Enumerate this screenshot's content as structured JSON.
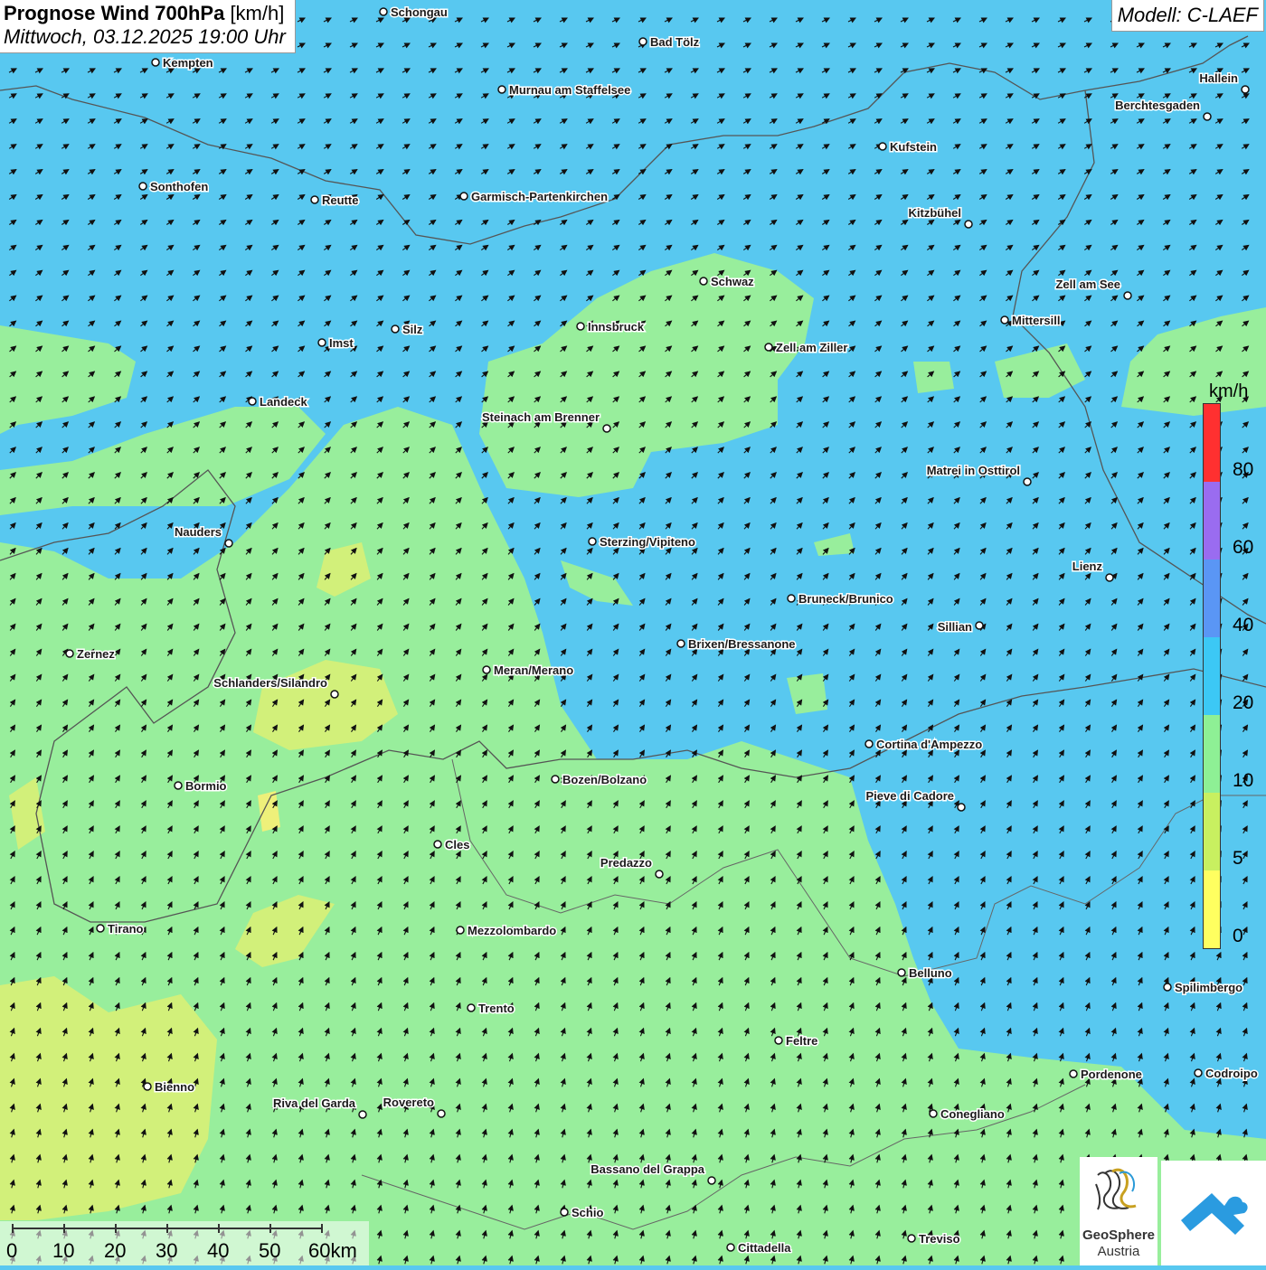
{
  "header": {
    "title_bold": "Prognose Wind 700hPa",
    "title_unit": "[km/h]",
    "datetime": "Mittwoch, 03.12.2025 19:00 Uhr",
    "model": "Modell: C-LAEF"
  },
  "legend": {
    "unit": "km/h",
    "stops": [
      {
        "label": "80",
        "color": "#ff3030"
      },
      {
        "label": "60",
        "color": "#9a6cf0"
      },
      {
        "label": "40",
        "color": "#5a96f5"
      },
      {
        "label": "20",
        "color": "#3cc8f5"
      },
      {
        "label": "10",
        "color": "#8ef095"
      },
      {
        "label": "5",
        "color": "#c8f060"
      },
      {
        "label": "0",
        "color": "#ffff60"
      }
    ],
    "labels_order": [
      "80",
      "60",
      "40",
      "20",
      "10",
      "5",
      "0"
    ]
  },
  "scalebar": {
    "labels": [
      "0",
      "10",
      "20",
      "30",
      "40",
      "50",
      "60km"
    ]
  },
  "brand": {
    "line1": "GeoSphere",
    "line2": "Austria"
  },
  "cities": [
    {
      "name": "Schongau"
    },
    {
      "name": "Bad Tölz"
    },
    {
      "name": "Kempten"
    },
    {
      "name": "Murnau am Staffelsee"
    },
    {
      "name": "Hallein"
    },
    {
      "name": "Berchtesgaden"
    },
    {
      "name": "Kufstein"
    },
    {
      "name": "Sonthofen"
    },
    {
      "name": "Reutte"
    },
    {
      "name": "Garmisch-Partenkirchen"
    },
    {
      "name": "Kitzbühel"
    },
    {
      "name": "Schwaz"
    },
    {
      "name": "Zell am See"
    },
    {
      "name": "Innsbruck"
    },
    {
      "name": "Mittersill"
    },
    {
      "name": "Silz"
    },
    {
      "name": "Imst"
    },
    {
      "name": "Zell am Ziller"
    },
    {
      "name": "Landeck"
    },
    {
      "name": "Steinach am Brenner"
    },
    {
      "name": "Matrei in Osttirol"
    },
    {
      "name": "Nauders"
    },
    {
      "name": "Sterzing/Vipiteno"
    },
    {
      "name": "Lienz"
    },
    {
      "name": "Bruneck/Brunico"
    },
    {
      "name": "Sillian"
    },
    {
      "name": "Zernez"
    },
    {
      "name": "Brixen/Bressanone"
    },
    {
      "name": "Meran/Merano"
    },
    {
      "name": "Schlanders/Silandro"
    },
    {
      "name": "Cortina d'Ampezzo"
    },
    {
      "name": "Bozen/Bolzano"
    },
    {
      "name": "Bormio"
    },
    {
      "name": "Pieve di Cadore"
    },
    {
      "name": "Cles"
    },
    {
      "name": "Predazzo"
    },
    {
      "name": "Tirano"
    },
    {
      "name": "Mezzolombardo"
    },
    {
      "name": "Belluno"
    },
    {
      "name": "Spilimbergo"
    },
    {
      "name": "Trento"
    },
    {
      "name": "Feltre"
    },
    {
      "name": "Pordenone"
    },
    {
      "name": "Codroipo"
    },
    {
      "name": "Bienno"
    },
    {
      "name": "Riva del Garda"
    },
    {
      "name": "Rovereto"
    },
    {
      "name": "Conegliano"
    },
    {
      "name": "Bassano del Grappa"
    },
    {
      "name": "Schio"
    },
    {
      "name": "Treviso"
    },
    {
      "name": "Cittadella"
    }
  ]
}
